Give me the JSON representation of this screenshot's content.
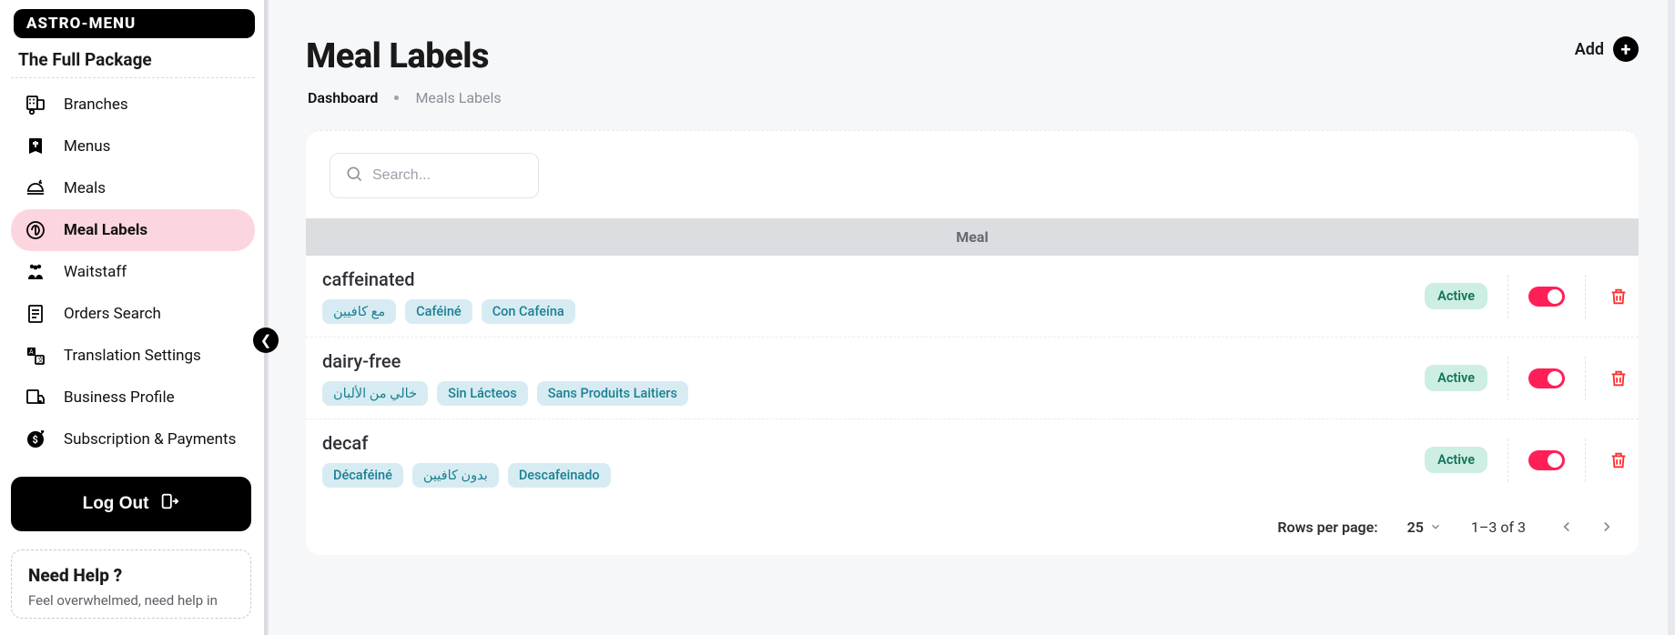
{
  "brand": {
    "logo": "ASTRO-MENU",
    "package": "The Full Package"
  },
  "sidebar": {
    "items": [
      {
        "label": "Branches",
        "active": false
      },
      {
        "label": "Menus",
        "active": false
      },
      {
        "label": "Meals",
        "active": false
      },
      {
        "label": "Meal Labels",
        "active": true
      },
      {
        "label": "Waitstaff",
        "active": false
      },
      {
        "label": "Orders Search",
        "active": false
      },
      {
        "label": "Translation Settings",
        "active": false
      },
      {
        "label": "Business Profile",
        "active": false
      },
      {
        "label": "Subscription & Payments",
        "active": false
      }
    ],
    "logout": "Log Out",
    "help": {
      "title": "Need Help ?",
      "sub": "Feel overwhelmed, need help in"
    }
  },
  "page": {
    "title": "Meal Labels",
    "add_label": "Add",
    "breadcrumbs": {
      "root": "Dashboard",
      "current": "Meals Labels"
    }
  },
  "search": {
    "placeholder": "Search..."
  },
  "table": {
    "header": "Meal",
    "rows": [
      {
        "title": "caffeinated",
        "chips": [
          "مع كافيين",
          "Caféiné",
          "Con Cafeína"
        ],
        "status": "Active",
        "enabled": true
      },
      {
        "title": "dairy-free",
        "chips": [
          "خالي من الألبان",
          "Sin Lácteos",
          "Sans Produits Laitiers"
        ],
        "status": "Active",
        "enabled": true
      },
      {
        "title": "decaf",
        "chips": [
          "Décaféiné",
          "بدون كافيين",
          "Descafeinado"
        ],
        "status": "Active",
        "enabled": true
      }
    ]
  },
  "pagination": {
    "rows_per_page_label": "Rows per page:",
    "rows_per_page_value": "25",
    "range_text": "1–3 of 3"
  },
  "colors": {
    "sidebar_active_bg": "#fcd6df",
    "chip_bg": "#d7ecf2",
    "chip_fg": "#1c7f94",
    "status_bg": "#cdeee2",
    "status_fg": "#11735a",
    "toggle_on": "#ff1f57",
    "danger": "#ff2e2e"
  }
}
